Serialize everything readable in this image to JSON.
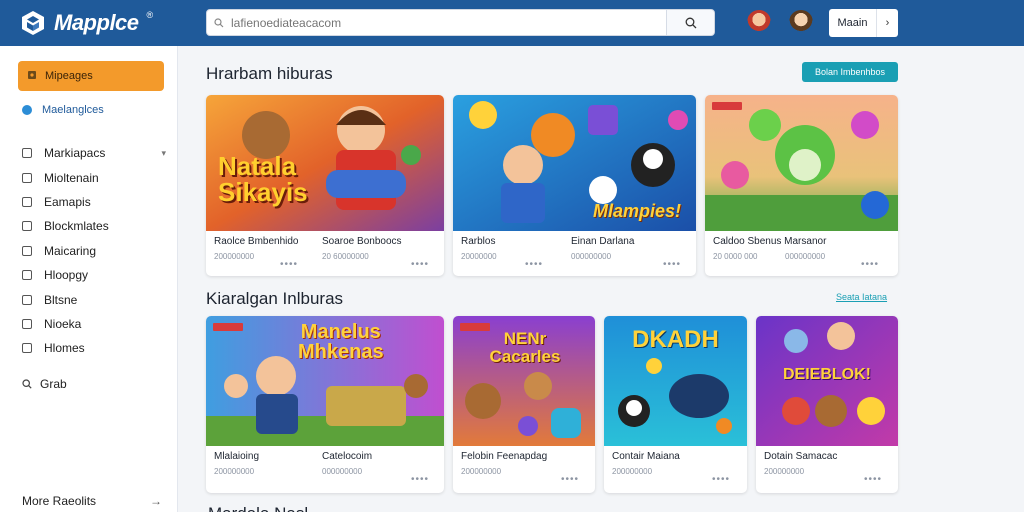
{
  "app": {
    "name": "Mapplce",
    "reg": "®"
  },
  "header": {
    "search_placeholder": "lafienoediateacacom",
    "login_label": "Maain",
    "login_chevron": "›"
  },
  "sidebar": {
    "active_label": "Mipeages",
    "second_label": "Maelanglces",
    "items": [
      {
        "label": "Markiapacs",
        "has_caret": true
      },
      {
        "label": "Mioltenain"
      },
      {
        "label": "Eamapis"
      },
      {
        "label": "Blockmlates"
      },
      {
        "label": "Maicaring"
      },
      {
        "label": "Hloopgy"
      },
      {
        "label": "Bltsne"
      },
      {
        "label": "Nioeka"
      },
      {
        "label": "Hlomes"
      }
    ],
    "grab_label": "Grab",
    "more_label": "More Raeolits",
    "more_arrow": "→"
  },
  "sections": [
    {
      "title": "Hrarbam hiburas",
      "action_label": "Bolan Imbenhbos",
      "cards": [
        {
          "title_a": "Raolce Bmbenhido",
          "title_b": "Soaroe Bonboocs",
          "meta_a": "200000000",
          "meta_b": "20 60000000",
          "art": "Natala\nSikayis"
        },
        {
          "title_a": "Rarblos",
          "title_b": "Einan Darlana",
          "meta_a": "20000000",
          "meta_b": "000000000",
          "art": "Mlampies!"
        },
        {
          "title_a": "Caldoo Sbenus Marsanor",
          "title_b": "",
          "meta_a": "20 0000 000",
          "meta_b": "000000000",
          "art": ""
        }
      ]
    },
    {
      "title": "Kiaralgan Inlburas",
      "action_label": "Seata Iatana",
      "cards": [
        {
          "title_a": "Mlalaioing",
          "title_b": "Catelocoim",
          "meta_a": "200000000",
          "meta_b": "000000000",
          "art": "Manelus\nMhkenas"
        },
        {
          "title_a": "Felobin Feenapdag",
          "title_b": "",
          "meta_a": "200000000",
          "meta_b": "",
          "art": "NENr\nCacarles"
        },
        {
          "title_a": "Contair Maiana",
          "title_b": "",
          "meta_a": "200000000",
          "meta_b": "",
          "art": "DKADH"
        },
        {
          "title_a": "Dotain Samacac",
          "title_b": "",
          "meta_a": "200000000",
          "meta_b": "",
          "art": "DEIEBLOK!"
        }
      ]
    }
  ],
  "peek_title": "Mardala Nasl",
  "colors": {
    "header": "#1f5a9a",
    "accent_orange": "#f39a2b",
    "accent_teal": "#1a9fb4"
  }
}
